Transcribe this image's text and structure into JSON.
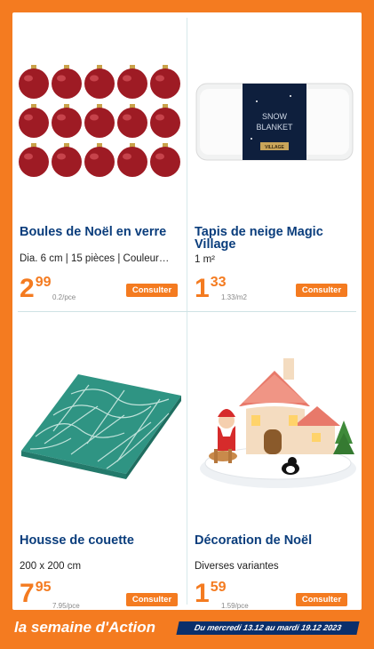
{
  "colors": {
    "accent": "#f47b20",
    "title": "#0a3d7c",
    "footer_badge": "#0a2f6b"
  },
  "products": [
    {
      "title": "Boules de Noël en verre",
      "subtitle": "Dia. 6 cm | 15 pièces | Couleur…",
      "price_int": "2",
      "price_dec": "99",
      "unit_price": "0.2/pce",
      "button": "Consulter",
      "image_icon": "christmas-baubles-image"
    },
    {
      "title": "Tapis de neige Magic Village",
      "subtitle": "1 m²",
      "price_int": "1",
      "price_dec": "33",
      "unit_price": "1.33/m2",
      "button": "Consulter",
      "image_icon": "snow-blanket-image",
      "package_text_1": "SNOW",
      "package_text_2": "BLANKET",
      "package_brand": "VILLAGE"
    },
    {
      "title": "Housse de couette",
      "subtitle": "200 x 200 cm",
      "price_int": "7",
      "price_dec": "95",
      "unit_price": "7.95/pce",
      "button": "Consulter",
      "image_icon": "duvet-cover-image"
    },
    {
      "title": "Décoration de Noël",
      "subtitle": "Diverses variantes",
      "price_int": "1",
      "price_dec": "59",
      "unit_price": "1.59/pce",
      "button": "Consulter",
      "image_icon": "christmas-house-image"
    }
  ],
  "footer": {
    "brand": "la semaine d'Action",
    "dates": "Du mercredi 13.12 au mardi 19.12 2023"
  }
}
